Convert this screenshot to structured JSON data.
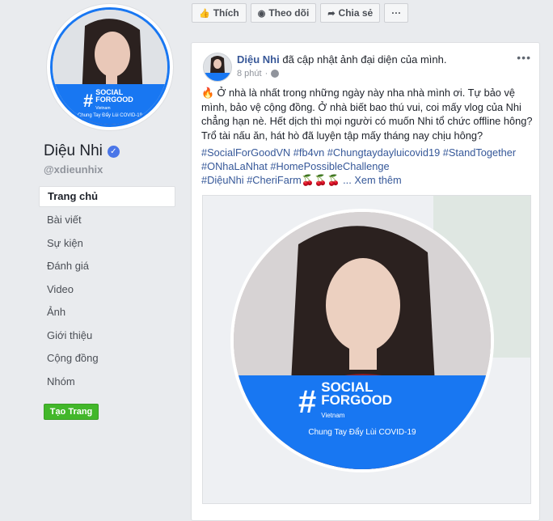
{
  "profile": {
    "name": "Diệu Nhi",
    "handle": "@xdieunhix",
    "badge": {
      "hashtag": "#",
      "line1": "SOCIAL",
      "line2": "FORGOOD",
      "country": "Vietnam",
      "sub": "Chung Tay Đẩy Lùi COVID-19"
    }
  },
  "nav": {
    "items": [
      "Trang chủ",
      "Bài viết",
      "Sự kiện",
      "Đánh giá",
      "Video",
      "Ảnh",
      "Giới thiệu",
      "Cộng đồng",
      "Nhóm"
    ],
    "create_button": "Tạo Trang"
  },
  "toolbar": {
    "like": "Thích",
    "follow": "Theo dõi",
    "share": "Chia sẻ",
    "more": "···"
  },
  "post": {
    "author": "Diệu Nhi",
    "action": "đã cập nhật ảnh đại diện của mình.",
    "time": "8 phút",
    "more": "•••",
    "text": "🔥 Ở nhà là nhất trong những ngày này nha nhà mình ơi. Tự bảo vệ mình, bảo vệ cộng đồng. Ở nhà biết bao thú vui, coi mấy vlog của Nhi chẳng hạn nè. Hết dịch thì mọi người có muốn Nhi tổ chức offline hông? Trổ tài nấu ăn, hát hò đã luyện tập mấy tháng nay chịu hông?",
    "tags_line1": "#SocialForGoodVN #fb4vn #Chungtaydayluicovid19 #StandTogether",
    "tags_line2": "#ONhaLaNhat #HomePossibleChallenge",
    "tags_line3": "#DiệuNhi #CheriFarm🍒🍒🍒 ...",
    "see_more": "Xem thêm",
    "image_badge": {
      "hashtag": "#",
      "line1": "SOCIAL",
      "line2": "FORGOOD",
      "country": "Vietnam",
      "sub": "Chung Tay Đẩy Lùi COVID-19"
    }
  },
  "colors": {
    "brand": "#1877f2",
    "link": "#365899",
    "green": "#42b72a"
  }
}
